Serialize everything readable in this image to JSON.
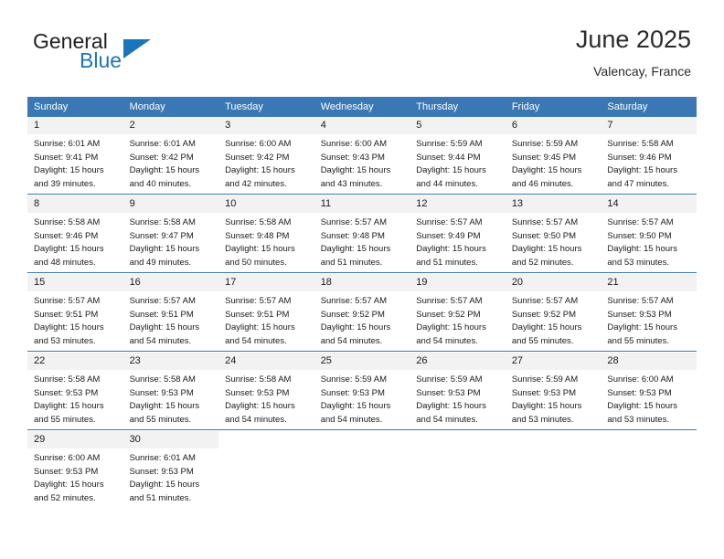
{
  "brand": {
    "name_top": "General",
    "name_bottom": "Blue",
    "accent_color": "#1b75bb"
  },
  "header": {
    "title": "June 2025",
    "location": "Valencay, France"
  },
  "theme": {
    "header_bg": "#3a78b5",
    "daynum_bg": "#f2f2f2",
    "separator": "#3a78b5"
  },
  "calendar": {
    "weekday_headers": [
      "Sunday",
      "Monday",
      "Tuesday",
      "Wednesday",
      "Thursday",
      "Friday",
      "Saturday"
    ],
    "labels": {
      "sunrise": "Sunrise:",
      "sunset": "Sunset:",
      "daylight": "Daylight:"
    },
    "weeks": [
      [
        {
          "day": "1",
          "sunrise": "Sunrise: 6:01 AM",
          "sunset": "Sunset: 9:41 PM",
          "daylight": "Daylight: 15 hours and 39 minutes."
        },
        {
          "day": "2",
          "sunrise": "Sunrise: 6:01 AM",
          "sunset": "Sunset: 9:42 PM",
          "daylight": "Daylight: 15 hours and 40 minutes."
        },
        {
          "day": "3",
          "sunrise": "Sunrise: 6:00 AM",
          "sunset": "Sunset: 9:42 PM",
          "daylight": "Daylight: 15 hours and 42 minutes."
        },
        {
          "day": "4",
          "sunrise": "Sunrise: 6:00 AM",
          "sunset": "Sunset: 9:43 PM",
          "daylight": "Daylight: 15 hours and 43 minutes."
        },
        {
          "day": "5",
          "sunrise": "Sunrise: 5:59 AM",
          "sunset": "Sunset: 9:44 PM",
          "daylight": "Daylight: 15 hours and 44 minutes."
        },
        {
          "day": "6",
          "sunrise": "Sunrise: 5:59 AM",
          "sunset": "Sunset: 9:45 PM",
          "daylight": "Daylight: 15 hours and 46 minutes."
        },
        {
          "day": "7",
          "sunrise": "Sunrise: 5:58 AM",
          "sunset": "Sunset: 9:46 PM",
          "daylight": "Daylight: 15 hours and 47 minutes."
        }
      ],
      [
        {
          "day": "8",
          "sunrise": "Sunrise: 5:58 AM",
          "sunset": "Sunset: 9:46 PM",
          "daylight": "Daylight: 15 hours and 48 minutes."
        },
        {
          "day": "9",
          "sunrise": "Sunrise: 5:58 AM",
          "sunset": "Sunset: 9:47 PM",
          "daylight": "Daylight: 15 hours and 49 minutes."
        },
        {
          "day": "10",
          "sunrise": "Sunrise: 5:58 AM",
          "sunset": "Sunset: 9:48 PM",
          "daylight": "Daylight: 15 hours and 50 minutes."
        },
        {
          "day": "11",
          "sunrise": "Sunrise: 5:57 AM",
          "sunset": "Sunset: 9:48 PM",
          "daylight": "Daylight: 15 hours and 51 minutes."
        },
        {
          "day": "12",
          "sunrise": "Sunrise: 5:57 AM",
          "sunset": "Sunset: 9:49 PM",
          "daylight": "Daylight: 15 hours and 51 minutes."
        },
        {
          "day": "13",
          "sunrise": "Sunrise: 5:57 AM",
          "sunset": "Sunset: 9:50 PM",
          "daylight": "Daylight: 15 hours and 52 minutes."
        },
        {
          "day": "14",
          "sunrise": "Sunrise: 5:57 AM",
          "sunset": "Sunset: 9:50 PM",
          "daylight": "Daylight: 15 hours and 53 minutes."
        }
      ],
      [
        {
          "day": "15",
          "sunrise": "Sunrise: 5:57 AM",
          "sunset": "Sunset: 9:51 PM",
          "daylight": "Daylight: 15 hours and 53 minutes."
        },
        {
          "day": "16",
          "sunrise": "Sunrise: 5:57 AM",
          "sunset": "Sunset: 9:51 PM",
          "daylight": "Daylight: 15 hours and 54 minutes."
        },
        {
          "day": "17",
          "sunrise": "Sunrise: 5:57 AM",
          "sunset": "Sunset: 9:51 PM",
          "daylight": "Daylight: 15 hours and 54 minutes."
        },
        {
          "day": "18",
          "sunrise": "Sunrise: 5:57 AM",
          "sunset": "Sunset: 9:52 PM",
          "daylight": "Daylight: 15 hours and 54 minutes."
        },
        {
          "day": "19",
          "sunrise": "Sunrise: 5:57 AM",
          "sunset": "Sunset: 9:52 PM",
          "daylight": "Daylight: 15 hours and 54 minutes."
        },
        {
          "day": "20",
          "sunrise": "Sunrise: 5:57 AM",
          "sunset": "Sunset: 9:52 PM",
          "daylight": "Daylight: 15 hours and 55 minutes."
        },
        {
          "day": "21",
          "sunrise": "Sunrise: 5:57 AM",
          "sunset": "Sunset: 9:53 PM",
          "daylight": "Daylight: 15 hours and 55 minutes."
        }
      ],
      [
        {
          "day": "22",
          "sunrise": "Sunrise: 5:58 AM",
          "sunset": "Sunset: 9:53 PM",
          "daylight": "Daylight: 15 hours and 55 minutes."
        },
        {
          "day": "23",
          "sunrise": "Sunrise: 5:58 AM",
          "sunset": "Sunset: 9:53 PM",
          "daylight": "Daylight: 15 hours and 55 minutes."
        },
        {
          "day": "24",
          "sunrise": "Sunrise: 5:58 AM",
          "sunset": "Sunset: 9:53 PM",
          "daylight": "Daylight: 15 hours and 54 minutes."
        },
        {
          "day": "25",
          "sunrise": "Sunrise: 5:59 AM",
          "sunset": "Sunset: 9:53 PM",
          "daylight": "Daylight: 15 hours and 54 minutes."
        },
        {
          "day": "26",
          "sunrise": "Sunrise: 5:59 AM",
          "sunset": "Sunset: 9:53 PM",
          "daylight": "Daylight: 15 hours and 54 minutes."
        },
        {
          "day": "27",
          "sunrise": "Sunrise: 5:59 AM",
          "sunset": "Sunset: 9:53 PM",
          "daylight": "Daylight: 15 hours and 53 minutes."
        },
        {
          "day": "28",
          "sunrise": "Sunrise: 6:00 AM",
          "sunset": "Sunset: 9:53 PM",
          "daylight": "Daylight: 15 hours and 53 minutes."
        }
      ],
      [
        {
          "day": "29",
          "sunrise": "Sunrise: 6:00 AM",
          "sunset": "Sunset: 9:53 PM",
          "daylight": "Daylight: 15 hours and 52 minutes."
        },
        {
          "day": "30",
          "sunrise": "Sunrise: 6:01 AM",
          "sunset": "Sunset: 9:53 PM",
          "daylight": "Daylight: 15 hours and 51 minutes."
        },
        {
          "day": "",
          "sunrise": "",
          "sunset": "",
          "daylight": ""
        },
        {
          "day": "",
          "sunrise": "",
          "sunset": "",
          "daylight": ""
        },
        {
          "day": "",
          "sunrise": "",
          "sunset": "",
          "daylight": ""
        },
        {
          "day": "",
          "sunrise": "",
          "sunset": "",
          "daylight": ""
        },
        {
          "day": "",
          "sunrise": "",
          "sunset": "",
          "daylight": ""
        }
      ]
    ]
  }
}
